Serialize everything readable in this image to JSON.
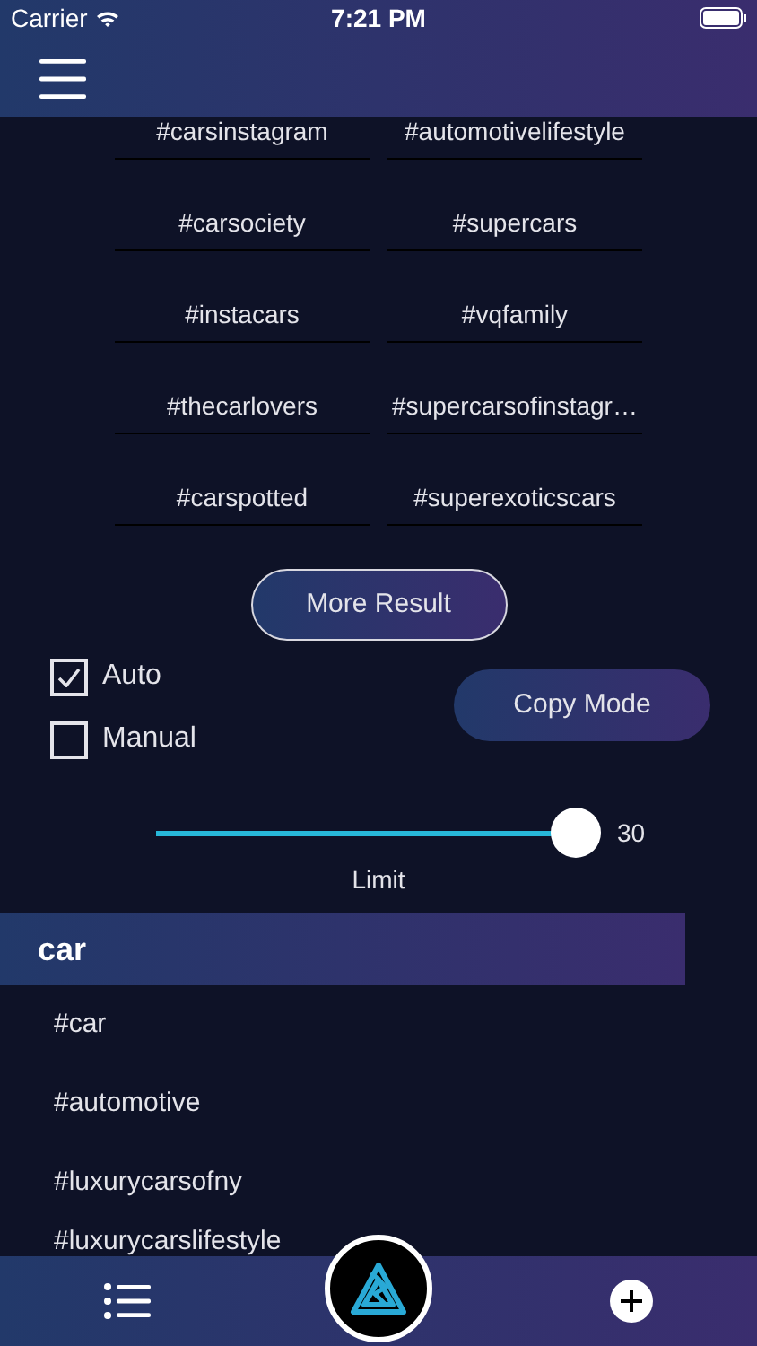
{
  "status_bar": {
    "carrier": "Carrier",
    "time": "7:21 PM"
  },
  "tags": [
    {
      "text": "#carsinstagram"
    },
    {
      "text": "#automotivelifestyle"
    },
    {
      "text": "#carsociety"
    },
    {
      "text": "#supercars"
    },
    {
      "text": "#instacars"
    },
    {
      "text": "#vqfamily"
    },
    {
      "text": "#thecarlovers"
    },
    {
      "text": "#supercarsofinstagr…"
    },
    {
      "text": "#carspotted"
    },
    {
      "text": "#superexoticscars"
    }
  ],
  "more_button": "More Result",
  "modes": [
    {
      "label": "Auto",
      "checked": true
    },
    {
      "label": "Manual",
      "checked": false
    }
  ],
  "copy_button": "Copy Mode",
  "limit": {
    "level": 1,
    "reading": "30",
    "label": "Limit"
  },
  "section": {
    "title": "car",
    "items": [
      "#car",
      "#automotive",
      "#luxurycarsofny",
      "#luxurycarslifestyle"
    ]
  }
}
